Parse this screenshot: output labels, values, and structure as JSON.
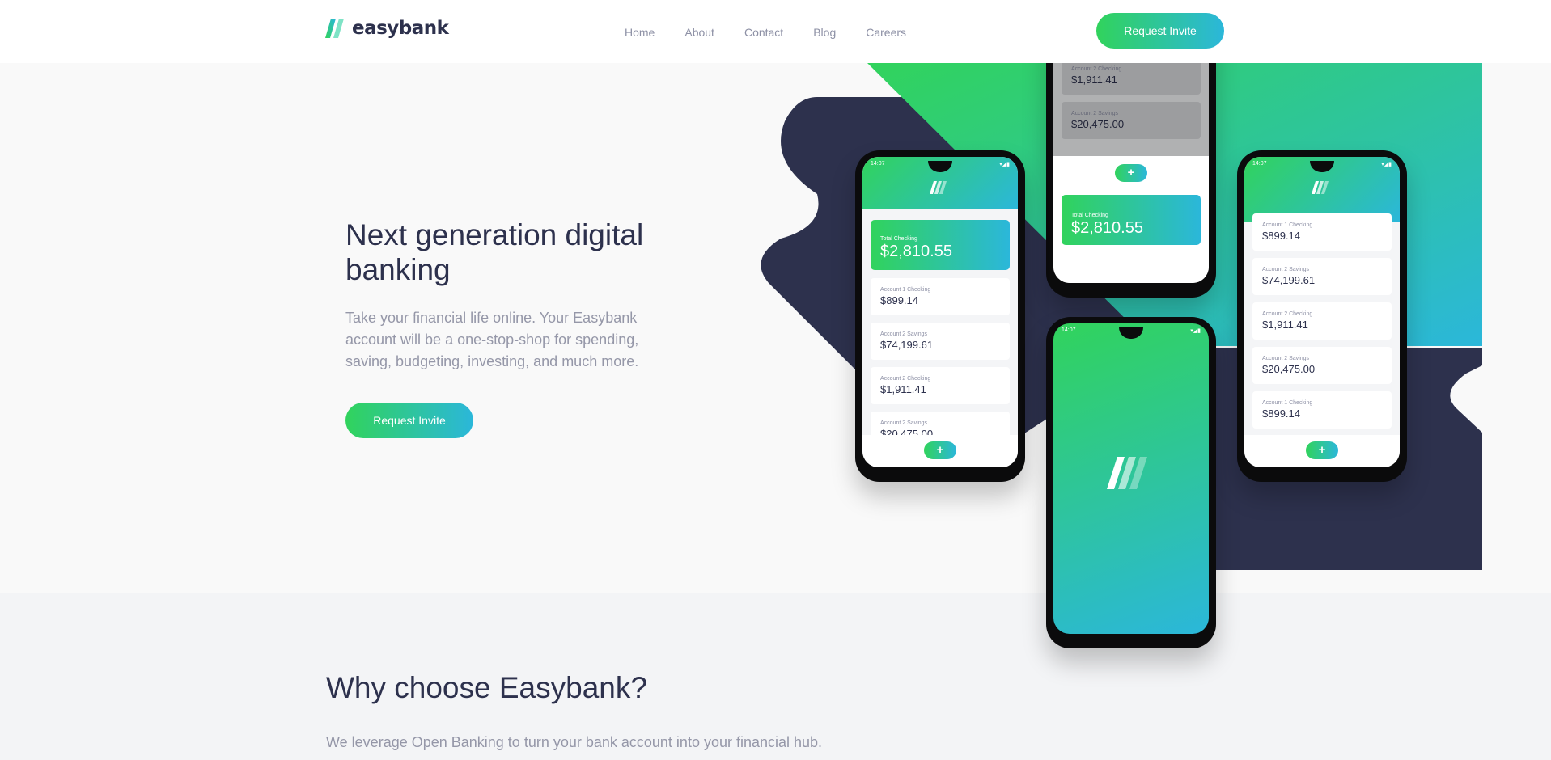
{
  "brand": {
    "name": "easybank"
  },
  "nav": {
    "items": [
      "Home",
      "About",
      "Contact",
      "Blog",
      "Careers"
    ]
  },
  "header": {
    "cta_label": "Request Invite"
  },
  "hero": {
    "title": "Next generation digital banking",
    "description": "Take your financial life online. Your Easybank account will be a one-stop-shop for spending, saving, budgeting, investing, and much more.",
    "cta_label": "Request Invite"
  },
  "why": {
    "title": "Why choose Easybank?",
    "description": "We leverage Open Banking to turn your bank account into your financial hub."
  },
  "phones": {
    "time": "14:07",
    "balance_label": "Total Checking",
    "balance_value": "$2,810.55",
    "fab_symbol": "+",
    "accounts": [
      {
        "label": "Account 1 Checking",
        "value": "$899.14"
      },
      {
        "label": "Account 2 Savings",
        "value": "$74,199.61"
      },
      {
        "label": "Account 2 Checking",
        "value": "$1,911.41"
      },
      {
        "label": "Account 2 Savings",
        "value": "$20,475.00"
      },
      {
        "label": "Account 1 Checking",
        "value": "$899.14"
      }
    ]
  },
  "colors": {
    "dark_blue": "#2d314d",
    "lime_green": "#31d35c",
    "bright_cyan": "#2bb7da",
    "grayish_blue": "#9597a8",
    "light_grayish_blue": "#f3f4f6"
  },
  "icons": {
    "logo_mark": "logo-slash-icon",
    "status": "signal-wifi-battery-icon",
    "fab": "plus-icon"
  }
}
